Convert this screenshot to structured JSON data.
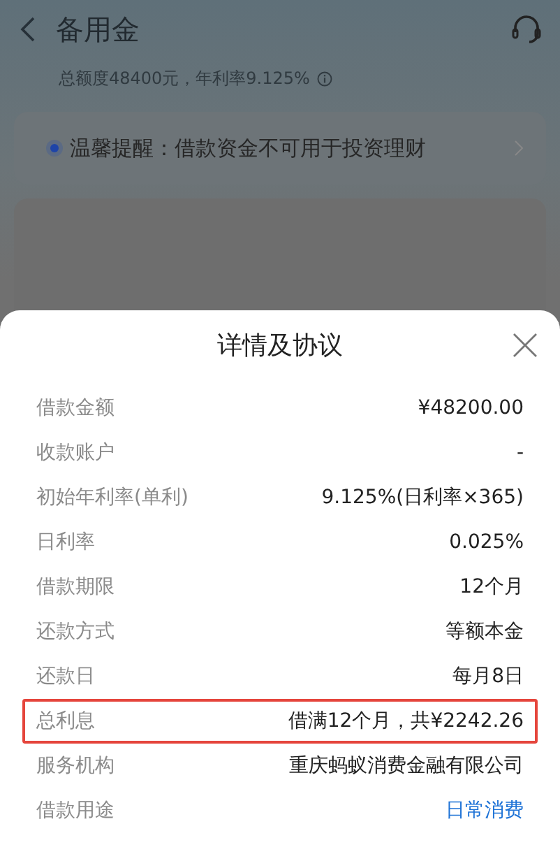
{
  "header": {
    "title": "备用金",
    "subtitle": "总额度48400元，年利率9.125%"
  },
  "notice": {
    "text": "温馨提醒：借款资金不可用于投资理财"
  },
  "sheet": {
    "title": "详情及协议",
    "rows": [
      {
        "label": "借款金额",
        "value": "¥48200.00",
        "highlighted": false,
        "kind": "text"
      },
      {
        "label": "收款账户",
        "value": "-",
        "highlighted": false,
        "kind": "text"
      },
      {
        "label": "初始年利率(单利)",
        "value": "9.125%(日利率×365)",
        "highlighted": false,
        "kind": "text"
      },
      {
        "label": "日利率",
        "value": "0.025%",
        "highlighted": false,
        "kind": "text"
      },
      {
        "label": "借款期限",
        "value": "12个月",
        "highlighted": false,
        "kind": "text"
      },
      {
        "label": "还款方式",
        "value": "等额本金",
        "highlighted": false,
        "kind": "text"
      },
      {
        "label": "还款日",
        "value": "每月8日",
        "highlighted": false,
        "kind": "text"
      },
      {
        "label": "总利息",
        "value": "借满12个月，共¥2242.26",
        "highlighted": true,
        "kind": "text"
      },
      {
        "label": "服务机构",
        "value": "重庆蚂蚁消费金融有限公司",
        "highlighted": false,
        "kind": "text"
      },
      {
        "label": "借款用途",
        "value": "日常消费",
        "highlighted": false,
        "kind": "link"
      }
    ]
  }
}
